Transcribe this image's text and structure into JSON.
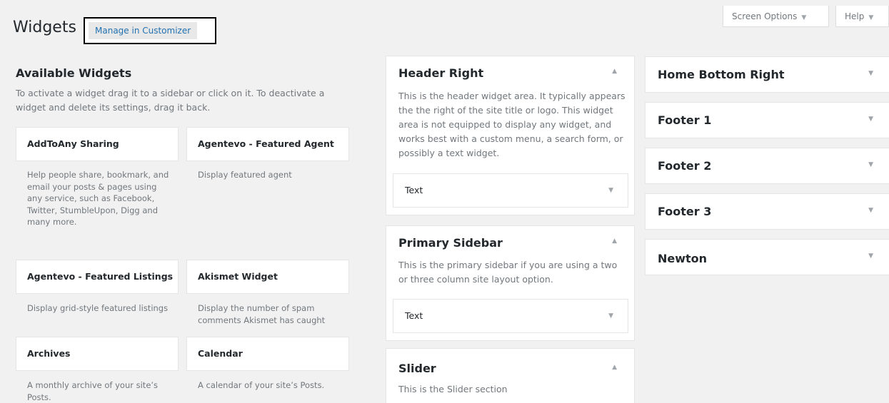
{
  "header": {
    "title": "Widgets",
    "manage_customizer": "Manage in Customizer",
    "screen_options": "Screen Options",
    "help": "Help"
  },
  "available": {
    "title": "Available Widgets",
    "description": "To activate a widget drag it to a sidebar or click on it. To deactivate a widget and delete its settings, drag it back.",
    "widgets": [
      {
        "title": "AddToAny Sharing",
        "desc": "Help people share, bookmark, and email your posts & pages using any service, such as Facebook, Twitter, StumbleUpon, Digg and many more."
      },
      {
        "title": "Agentevo - Featured Agent",
        "desc": "Display featured agent"
      },
      {
        "title": "Agentevo - Featured Listings",
        "desc": "Display grid-style featured listings"
      },
      {
        "title": "Akismet Widget",
        "desc": "Display the number of spam comments Akismet has caught"
      },
      {
        "title": "Archives",
        "desc": "A monthly archive of your site’s Posts."
      },
      {
        "title": "Calendar",
        "desc": "A calendar of your site’s Posts."
      }
    ]
  },
  "sidebars": {
    "header_right": {
      "title": "Header Right",
      "desc": "This is the header widget area. It typically appears the the right of the site title or logo. This widget area is not equipped to display any widget, and works best with a custom menu, a search form, or possibly a text widget.",
      "widget": "Text"
    },
    "primary": {
      "title": "Primary Sidebar",
      "desc": "This is the primary sidebar if you are using a two or three column site layout option.",
      "widget": "Text"
    },
    "slider": {
      "title": "Slider",
      "desc": "This is the Slider section"
    },
    "right": [
      "Home Bottom Right",
      "Footer 1",
      "Footer 2",
      "Footer 3",
      "Newton"
    ]
  },
  "icons": {
    "collapse": "arrow-up-icon",
    "expand": "arrow-down-icon"
  }
}
